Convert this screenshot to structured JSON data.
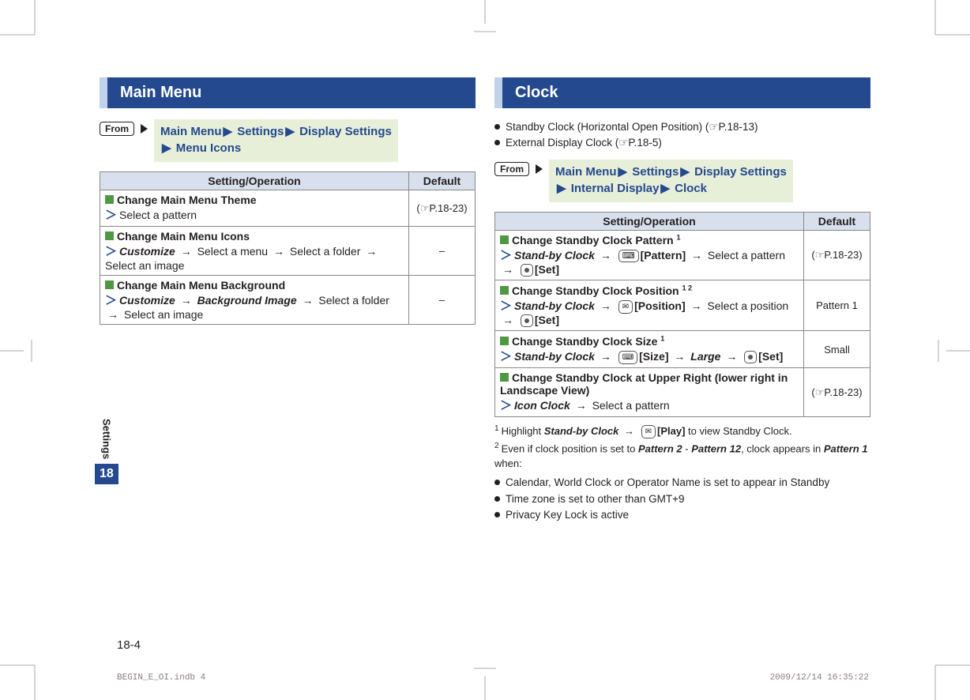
{
  "sideTab": {
    "label": "Settings",
    "number": "18"
  },
  "pageNumber": "18-4",
  "footer": {
    "left": "BEGIN_E_OI.indb   4",
    "right": "2009/12/14   16:35:22"
  },
  "left": {
    "title": "Main Menu",
    "fromLabel": "From",
    "path": [
      "Main Menu",
      "Settings",
      "Display Settings",
      "Menu Icons"
    ],
    "headers": {
      "col1": "Setting/Operation",
      "col2": "Default"
    },
    "rows": [
      {
        "title": "Change Main Menu Theme",
        "steps": "Select a pattern",
        "default": "(☞P.18-23)"
      },
      {
        "title": "Change Main Menu Icons",
        "steps_html": "<em class='bi'>Customize</em> <span class='arrow'>→</span> Select a menu <span class='arrow'>→</span> Select a folder <span class='arrow'>→</span> Select an image",
        "default": "–"
      },
      {
        "title": "Change Main Menu Background",
        "steps_html": "<em class='bi'>Customize</em> <span class='arrow'>→</span> <em class='bi'>Background Image</em> <span class='arrow'>→</span> Select a folder <span class='arrow'>→</span> Select an image",
        "default": "–"
      }
    ]
  },
  "right": {
    "title": "Clock",
    "preBullets": [
      "Standby Clock (Horizontal Open Position) (☞P.18-13)",
      "External Display Clock (☞P.18-5)"
    ],
    "fromLabel": "From",
    "path": [
      "Main Menu",
      "Settings",
      "Display Settings",
      "Internal Display",
      "Clock"
    ],
    "headers": {
      "col1": "Setting/Operation",
      "col2": "Default"
    },
    "rows": [
      {
        "title_html": "Change Standby Clock Pattern <sup class='tiny'>1</sup>",
        "steps_html": "<em class='bi'>Stand-by Clock</em> <span class='arrow'>→</span> <span class='key'>⌨</span><b>[Pattern]</b> <span class='arrow'>→</span> Select a pattern <span class='arrow'>→</span> <span class='key dot'></span><b>[Set]</b>",
        "default": "(☞P.18-23)"
      },
      {
        "title_html": "Change Standby Clock Position <sup class='tiny'>1 2</sup>",
        "steps_html": "<em class='bi'>Stand-by Clock</em> <span class='arrow'>→</span> <span class='key env'></span><b>[Position]</b> <span class='arrow'>→</span> Select a position <span class='arrow'>→</span> <span class='key dot'></span><b>[Set]</b>",
        "default": "Pattern 1"
      },
      {
        "title_html": "Change Standby Clock Size <sup class='tiny'>1</sup>",
        "steps_html": "<em class='bi'>Stand-by Clock</em> <span class='arrow'>→</span> <span class='key cam'></span><b>[Size]</b> <span class='arrow'>→</span> <em class='bi'>Large</em> <span class='arrow'>→</span> <span class='key dot'></span><b>[Set]</b>",
        "default": "Small"
      },
      {
        "title_html": "Change Standby Clock at Upper Right (lower right in Landscape View)",
        "steps_html": "<em class='bi'>Icon Clock</em> <span class='arrow'>→</span> Select a pattern",
        "default": "(☞P.18-23)"
      }
    ],
    "footnotes": [
      {
        "num": "1",
        "html": "Highlight <em class='bi'>Stand-by Clock</em> <span class='arrow'>→</span> <span class='key env'></span><b>[Play]</b> to view Standby Clock."
      },
      {
        "num": "2",
        "html": "Even if clock position is set to <em class='bi'>Pattern 2</em> - <em class='bi'>Pattern 12</em>, clock appears in <em class='bi'>Pattern 1</em> when:"
      }
    ],
    "postBullets": [
      "Calendar, World Clock or Operator Name is set to appear in Standby",
      "Time zone is set to other than GMT+9",
      "Privacy Key Lock is active"
    ]
  }
}
